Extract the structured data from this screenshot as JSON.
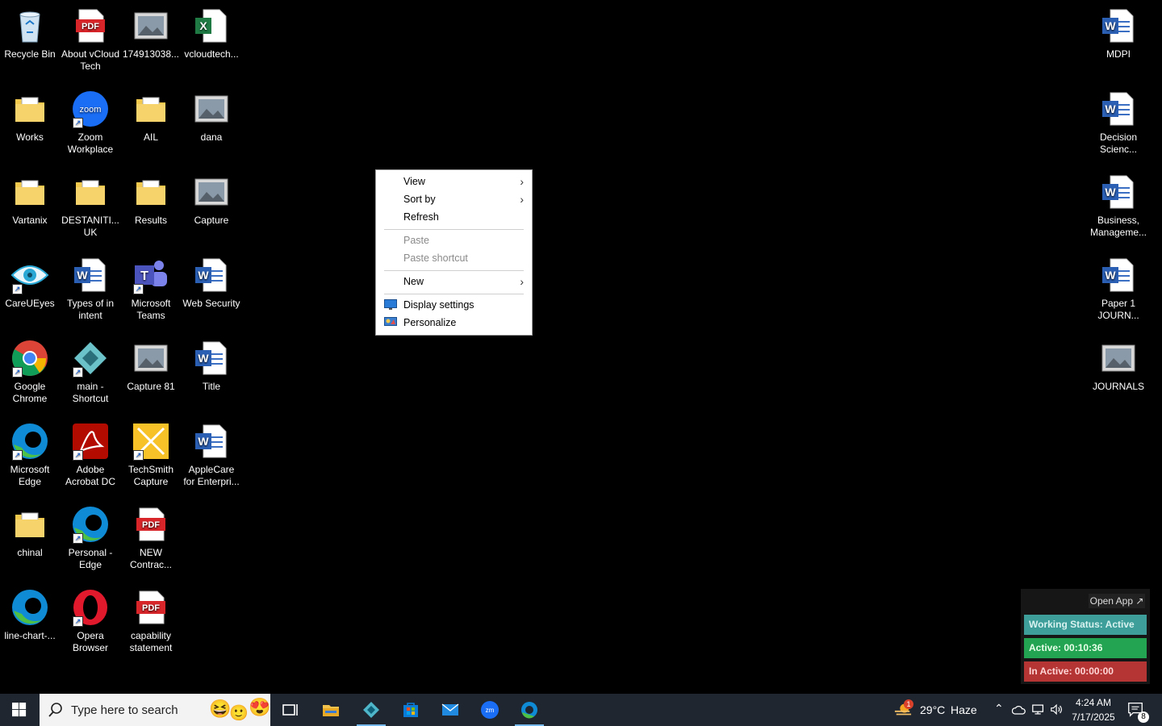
{
  "desktop_icons": [
    {
      "label": "Recycle Bin",
      "icon": "recycle-bin-icon"
    },
    {
      "label": "About vCloud Tech",
      "icon": "pdf-icon"
    },
    {
      "label": "174913038...",
      "icon": "image-file-icon"
    },
    {
      "label": "vcloudtech...",
      "icon": "excel-icon"
    },
    {
      "label": "Works",
      "icon": "folder-icon"
    },
    {
      "label": "Zoom Workplace",
      "icon": "zoom-icon"
    },
    {
      "label": "AIL",
      "icon": "folder-icon"
    },
    {
      "label": "dana",
      "icon": "image-file-icon"
    },
    {
      "label": "Vartanix",
      "icon": "folder-icon"
    },
    {
      "label": "DESTANITI... UK",
      "icon": "folder-icon"
    },
    {
      "label": "Results",
      "icon": "folder-icon"
    },
    {
      "label": "Capture",
      "icon": "image-file-icon"
    },
    {
      "label": "CareUEyes",
      "icon": "eye-icon"
    },
    {
      "label": "Types of in intent",
      "icon": "word-icon"
    },
    {
      "label": "Microsoft Teams",
      "icon": "teams-icon"
    },
    {
      "label": "Web Security",
      "icon": "word-icon"
    },
    {
      "label": "Google Chrome",
      "icon": "chrome-icon"
    },
    {
      "label": "main - Shortcut",
      "icon": "app-icon"
    },
    {
      "label": "Capture 81",
      "icon": "image-file-icon"
    },
    {
      "label": "Title",
      "icon": "word-icon"
    },
    {
      "label": "Microsoft Edge",
      "icon": "edge-icon"
    },
    {
      "label": "Adobe Acrobat DC",
      "icon": "acrobat-icon"
    },
    {
      "label": "TechSmith Capture",
      "icon": "techsmith-icon"
    },
    {
      "label": "AppleCare for Enterpri...",
      "icon": "word-icon"
    },
    {
      "label": "chinal",
      "icon": "folder-icon"
    },
    {
      "label": "Personal - Edge",
      "icon": "edge-icon"
    },
    {
      "label": "NEW Contrac...",
      "icon": "pdf-icon"
    },
    {
      "label": "line-chart-...",
      "icon": "edge-icon"
    },
    {
      "label": "Opera Browser",
      "icon": "opera-icon"
    },
    {
      "label": "capability statement",
      "icon": "pdf-icon"
    },
    {
      "label": "MDPI",
      "icon": "word-icon"
    },
    {
      "label": "Decision Scienc...",
      "icon": "word-icon"
    },
    {
      "label": "Business, Manageme...",
      "icon": "word-icon"
    },
    {
      "label": "Paper 1 JOURN...",
      "icon": "word-icon"
    },
    {
      "label": "JOURNALS",
      "icon": "image-file-icon"
    }
  ],
  "context_menu": {
    "view": "View",
    "sort_by": "Sort by",
    "refresh": "Refresh",
    "paste": "Paste",
    "paste_shortcut": "Paste shortcut",
    "new": "New",
    "display_settings": "Display settings",
    "personalize": "Personalize"
  },
  "status_widget": {
    "open_app": "Open App ↗",
    "working_status": "Working Status: Active",
    "active": "Active: 00:10:36",
    "inactive": "In Active: 00:00:00",
    "colors": {
      "working": "#3d9e9a",
      "active": "#23a453",
      "inactive": "#b53434"
    }
  },
  "taskbar": {
    "search_placeholder": "Type here to search",
    "weather_temp": "29°C",
    "weather_desc": "Haze",
    "weather_badge": "1",
    "time": "4:24 AM",
    "date": "7/17/2025",
    "notification_count": "8"
  }
}
